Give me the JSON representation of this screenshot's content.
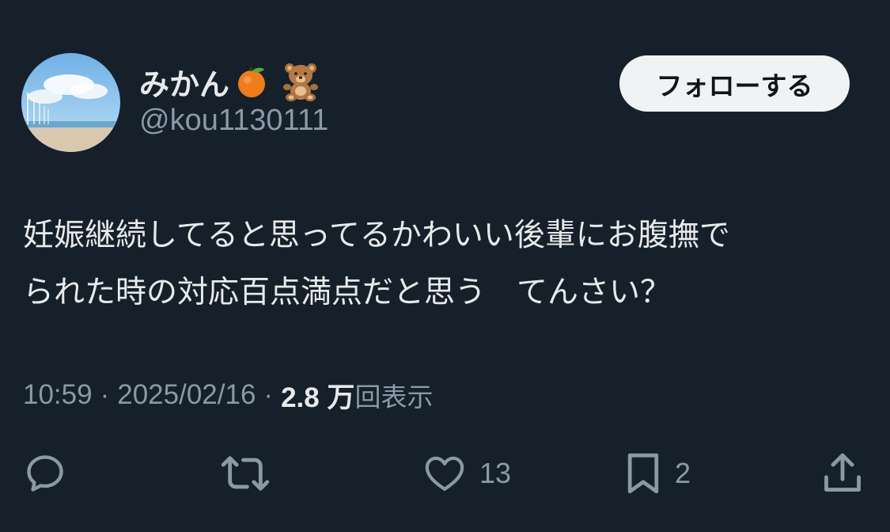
{
  "user": {
    "display_name": "みかん",
    "name_emojis": [
      "orange-icon",
      "teddy-bear-icon"
    ],
    "handle": "@kou1130111"
  },
  "follow_button_label": "フォローする",
  "tweet": {
    "text_lines": [
      "妊娠継続してると思ってるかわいい後輩にお腹撫で",
      "られた時の対応百点満点だと思う　てんさい？"
    ]
  },
  "meta": {
    "time": "10:59",
    "separator": "·",
    "date": "2025/02/16",
    "views_count": "2.8 万",
    "views_label": "回表示"
  },
  "actions": {
    "reply": {
      "icon": "reply-icon",
      "count": ""
    },
    "retweet": {
      "icon": "retweet-icon",
      "count": ""
    },
    "like": {
      "icon": "heart-icon",
      "count": "13"
    },
    "bookmark": {
      "icon": "bookmark-icon",
      "count": "2"
    },
    "share": {
      "icon": "share-icon",
      "count": ""
    }
  },
  "colors": {
    "background": "#15202b",
    "text_primary": "#e7e9ea",
    "text_secondary": "#8b98a5",
    "follow_button_bg": "#eff3f4"
  }
}
